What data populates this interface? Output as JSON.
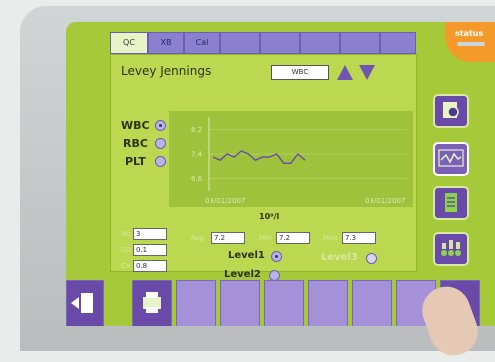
{
  "tabs": [
    "QC",
    "XB",
    "Cal",
    "",
    "",
    "",
    "",
    ""
  ],
  "title": "Levey Jennings",
  "parameter": "WBC",
  "selectors": [
    {
      "label": "WBC",
      "selected": true
    },
    {
      "label": "RBC",
      "selected": false
    },
    {
      "label": "PLT",
      "selected": false
    }
  ],
  "chart_data": {
    "type": "line",
    "y_ticks": [
      "8.2",
      "7.4",
      "6.6"
    ],
    "ylim": [
      6.2,
      8.6
    ],
    "x_start_label": "03/01/2007",
    "x_end_label": "03/01/2007",
    "values": [
      7.3,
      7.2,
      7.4,
      7.3,
      7.5,
      7.4,
      7.2,
      7.3,
      7.3,
      7.4,
      7.1,
      7.1,
      7.4,
      7.2
    ]
  },
  "unit": "10⁹/l",
  "stats": {
    "no_label": "No",
    "no_value": "3",
    "sd_label": "SD",
    "sd_value": "0.1",
    "cv_label": "CV",
    "cv_value": "0.8",
    "avg_label": "Avg",
    "avg_value": "7.2",
    "min_label": "Min",
    "min_value": "7.2",
    "max_label": "Max",
    "max_value": "7.3"
  },
  "levels": {
    "level1": "Level1",
    "level2": "Level2",
    "level3": "Level3"
  },
  "status_badge": "status",
  "colors": {
    "screen": "#a6c93a",
    "panel": "#bcd850",
    "purple": "#6a4aa8",
    "orange": "#f39a2a"
  }
}
